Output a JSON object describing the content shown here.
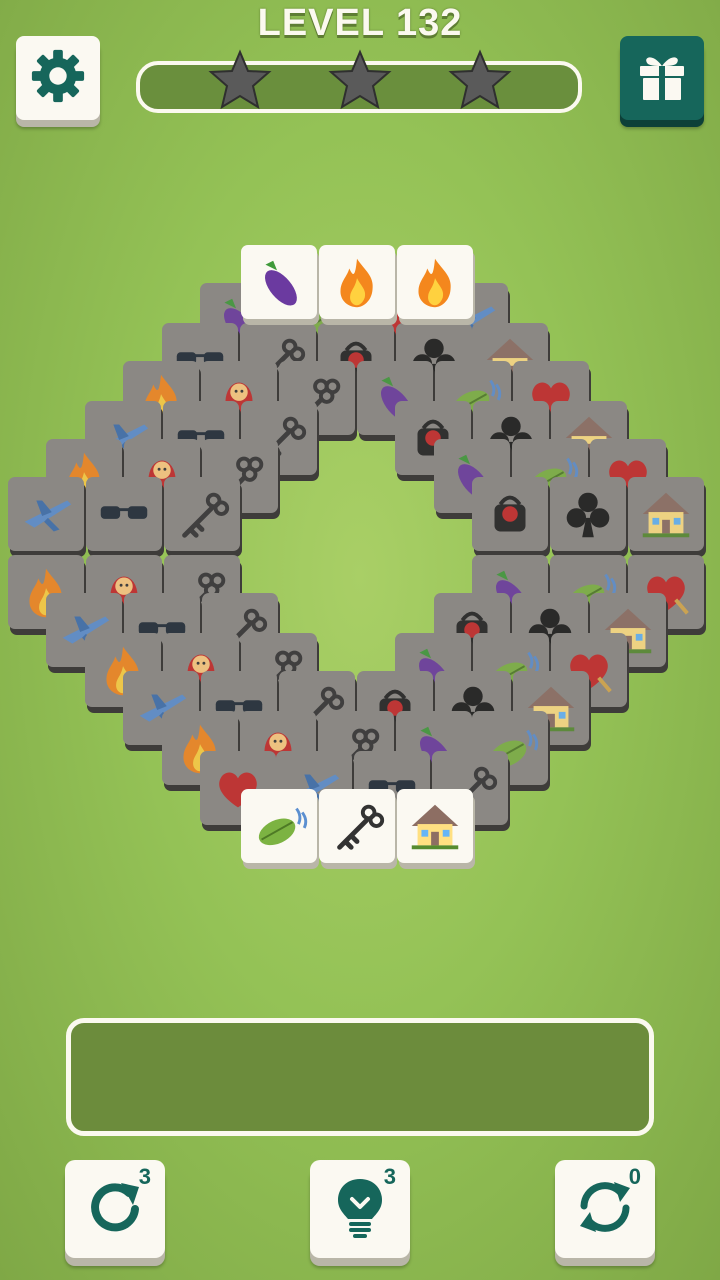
{
  "header": {
    "level_label": "LEVEL 132",
    "settings_icon": "gear-icon",
    "gift_icon": "gift-icon",
    "stars": [
      {
        "name": "star-1",
        "filled": false
      },
      {
        "name": "star-2",
        "filled": false
      },
      {
        "name": "star-3",
        "filled": false
      }
    ]
  },
  "board": {
    "free_tiles_top": [
      "eggplant",
      "fire",
      "fire"
    ],
    "free_tiles_bottom": [
      "leaf-wind",
      "key",
      "house"
    ],
    "locked_icon_set": [
      "eggplant",
      "leaf-wind",
      "heart",
      "plane",
      "sunglasses",
      "key",
      "bag",
      "club",
      "house",
      "fire",
      "doll",
      "orbit-key"
    ]
  },
  "tray": {
    "slots_filled": 0
  },
  "tools": {
    "undo": {
      "icon": "undo-icon",
      "count": "3"
    },
    "hint": {
      "icon": "lightbulb-icon",
      "count": "3"
    },
    "shuffle": {
      "icon": "shuffle-icon",
      "count": "0"
    }
  },
  "colors": {
    "background": "#94c256",
    "accent": "#16665b",
    "tile_face": "#fbf9f2",
    "tile_locked": "#8b8884"
  }
}
